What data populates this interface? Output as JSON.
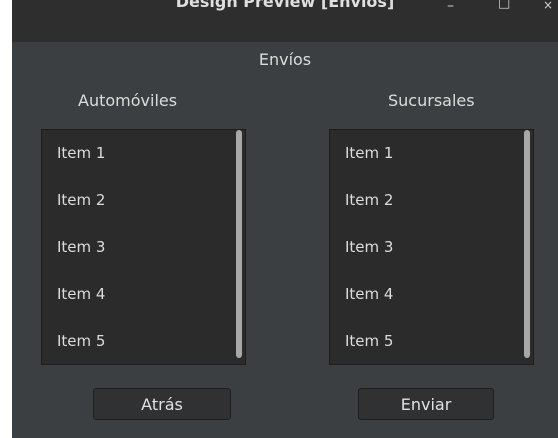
{
  "window": {
    "title": "Design Preview [Envios]",
    "controls": {
      "minimize": "–",
      "maximize": "□",
      "close": "×"
    }
  },
  "main": {
    "heading": "Envíos"
  },
  "automoviles": {
    "title": "Automóviles",
    "items": [
      "Item 1",
      "Item 2",
      "Item 3",
      "Item 4",
      "Item 5"
    ]
  },
  "sucursales": {
    "title": "Sucursales",
    "items": [
      "Item 1",
      "Item 2",
      "Item 3",
      "Item 4",
      "Item 5"
    ]
  },
  "buttons": {
    "back": "Atrás",
    "send": "Enviar"
  },
  "colors": {
    "window_bg": "#3c3f41",
    "list_bg": "#2b2b2b",
    "text": "#dcdcdc",
    "scroll_thumb": "#a8a8a8"
  }
}
